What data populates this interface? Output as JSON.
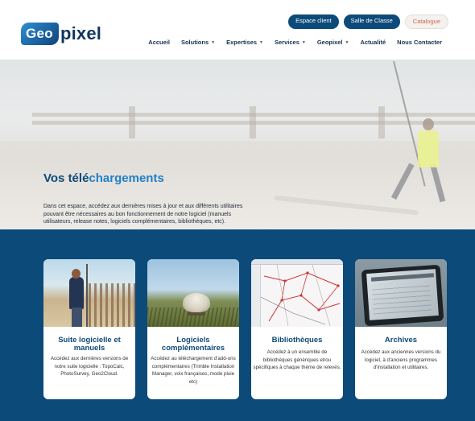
{
  "brand": {
    "logo_left": "Geo",
    "logo_right": "pixel"
  },
  "top_buttons": [
    {
      "label": "Espace client"
    },
    {
      "label": "Salle de Classe"
    },
    {
      "label": "Catalogue"
    }
  ],
  "nav": [
    {
      "label": "Accueil",
      "dropdown": false
    },
    {
      "label": "Solutions",
      "dropdown": true
    },
    {
      "label": "Expertises",
      "dropdown": true
    },
    {
      "label": "Services",
      "dropdown": true
    },
    {
      "label": "Geopixel",
      "dropdown": true
    },
    {
      "label": "Actualité",
      "dropdown": false
    },
    {
      "label": "Nous Contacter",
      "dropdown": false
    }
  ],
  "hero": {
    "title_part1": "Vos télé",
    "title_part2": "chargements",
    "text": "Dans cet espace, accédez aux dernières mises à jour et aux différents utilitaires pouvant être nécessaires au bon fonctionnement de notre logiciel (manuels utilisateurs, release notes, logiciels complémentaires, bibliothèques, etc)."
  },
  "cards": [
    {
      "title": "Suite logicielle et manuels",
      "text": "Accédez aux dernières versions de notre suite logicielle : TopoCalc, PhotoSurvey, Geo2Cloud."
    },
    {
      "title": "Logiciels complémentaires",
      "text": "Accédez au téléchargement d'add-ons complémentaires (Trimble Installation Manager, voix françaises, mode pluie etc)"
    },
    {
      "title": "Bibliothèques",
      "text": "Accédez à un ensemble de bibliothèques génériques et/ou spécifiques à chaque thème de relevés."
    },
    {
      "title": "Archives",
      "text": "Accédez aux anciennes versions du logiciel, à d'anciens programmes d'installation et utilitaires."
    }
  ],
  "colors": {
    "primary_dark_blue": "#0c4a7a",
    "accent_blue": "#1f7fc9",
    "catalogue_text": "#c86b54",
    "vest_yellow": "#d7e536"
  }
}
